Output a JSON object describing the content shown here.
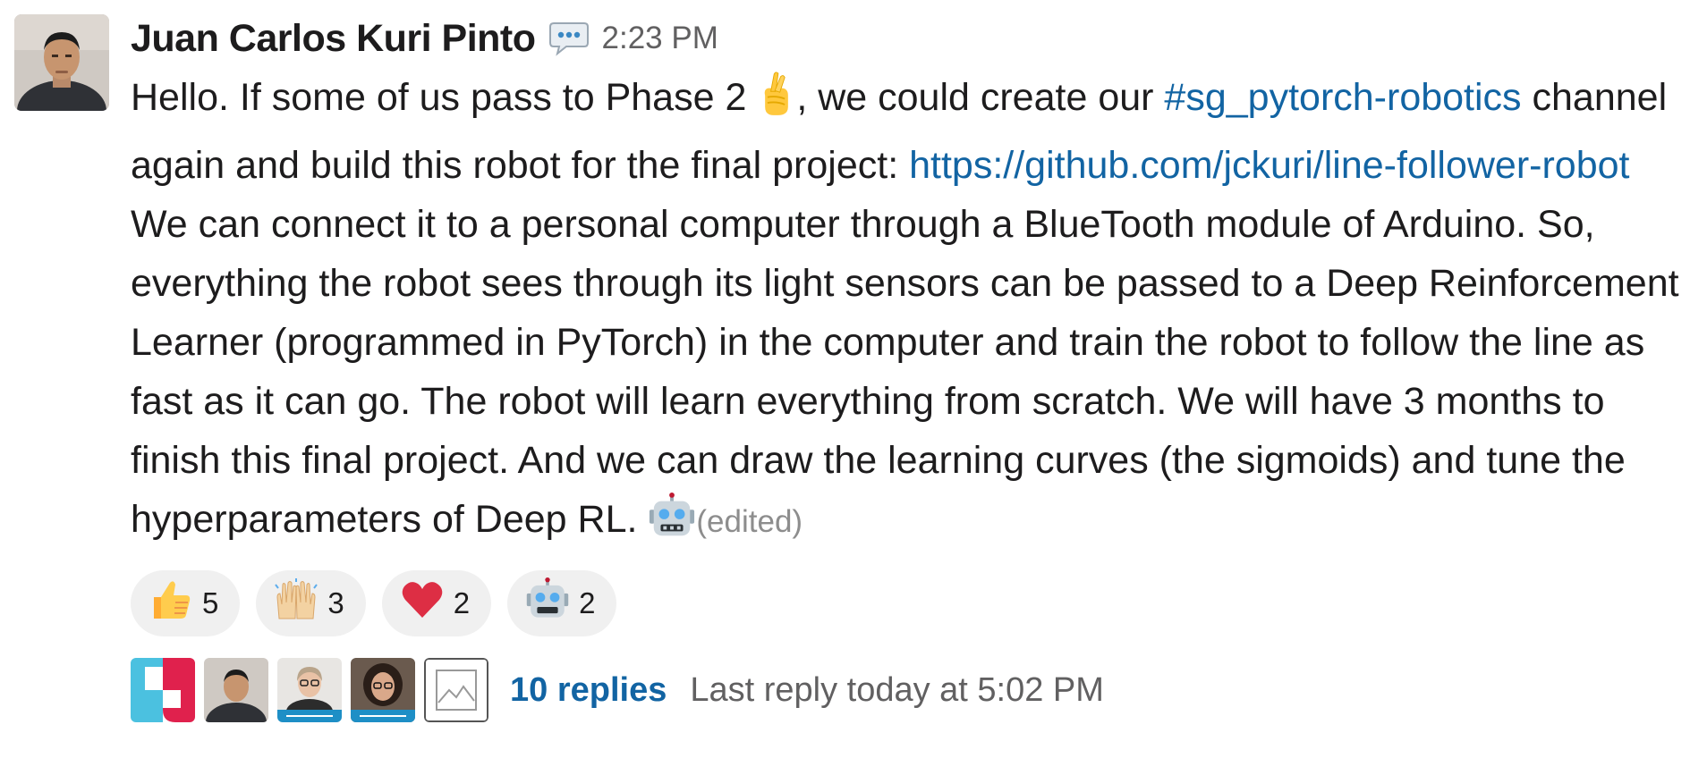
{
  "message": {
    "author": "Juan Carlos Kuri Pinto",
    "status_icon": "speech-bubble-icon",
    "timestamp": "2:23 PM",
    "line1_before": "Hello. If some of us pass to Phase 2 ",
    "line1_emoji": "crossed-fingers-icon",
    "line1_after": ", we could create our ",
    "channel_link": "#sg_pytorch-robotics",
    "line2_before": " channel again and build this robot for the final project: ",
    "url_link": "https://github.com/jckuri/line-follower-robot",
    "paragraph2": "We can connect it to a personal computer through a BlueTooth module of Arduino. So, everything the robot sees through its light sensors can be passed to a Deep Reinforcement Learner (programmed in PyTorch) in the computer and train the robot to follow the line as fast as it can go. The robot will learn everything from scratch. We will have 3 months to finish this final project. And we can draw the learning curves (the sigmoids) and tune the hyperparameters of Deep RL. ",
    "paragraph2_emoji": "robot-face-icon",
    "edited_label": "(edited)"
  },
  "reactions": [
    {
      "icon": "thumbs-up-icon",
      "count": "5"
    },
    {
      "icon": "raised-hands-icon",
      "count": "3"
    },
    {
      "icon": "red-heart-icon",
      "count": "2"
    },
    {
      "icon": "robot-face-icon",
      "count": "2"
    }
  ],
  "thread": {
    "repliers": [
      "replier-avatar-logo",
      "replier-avatar-juan",
      "replier-avatar-moderator-1",
      "replier-avatar-moderator-2",
      "replier-avatar-placeholder"
    ],
    "replies_label": "10 replies",
    "last_reply": "Last reply today at 5:02 PM"
  },
  "colors": {
    "link": "#1264a3",
    "timestamp": "#616061",
    "reaction_bg": "#f0f0f0",
    "text": "#1d1c1d"
  }
}
